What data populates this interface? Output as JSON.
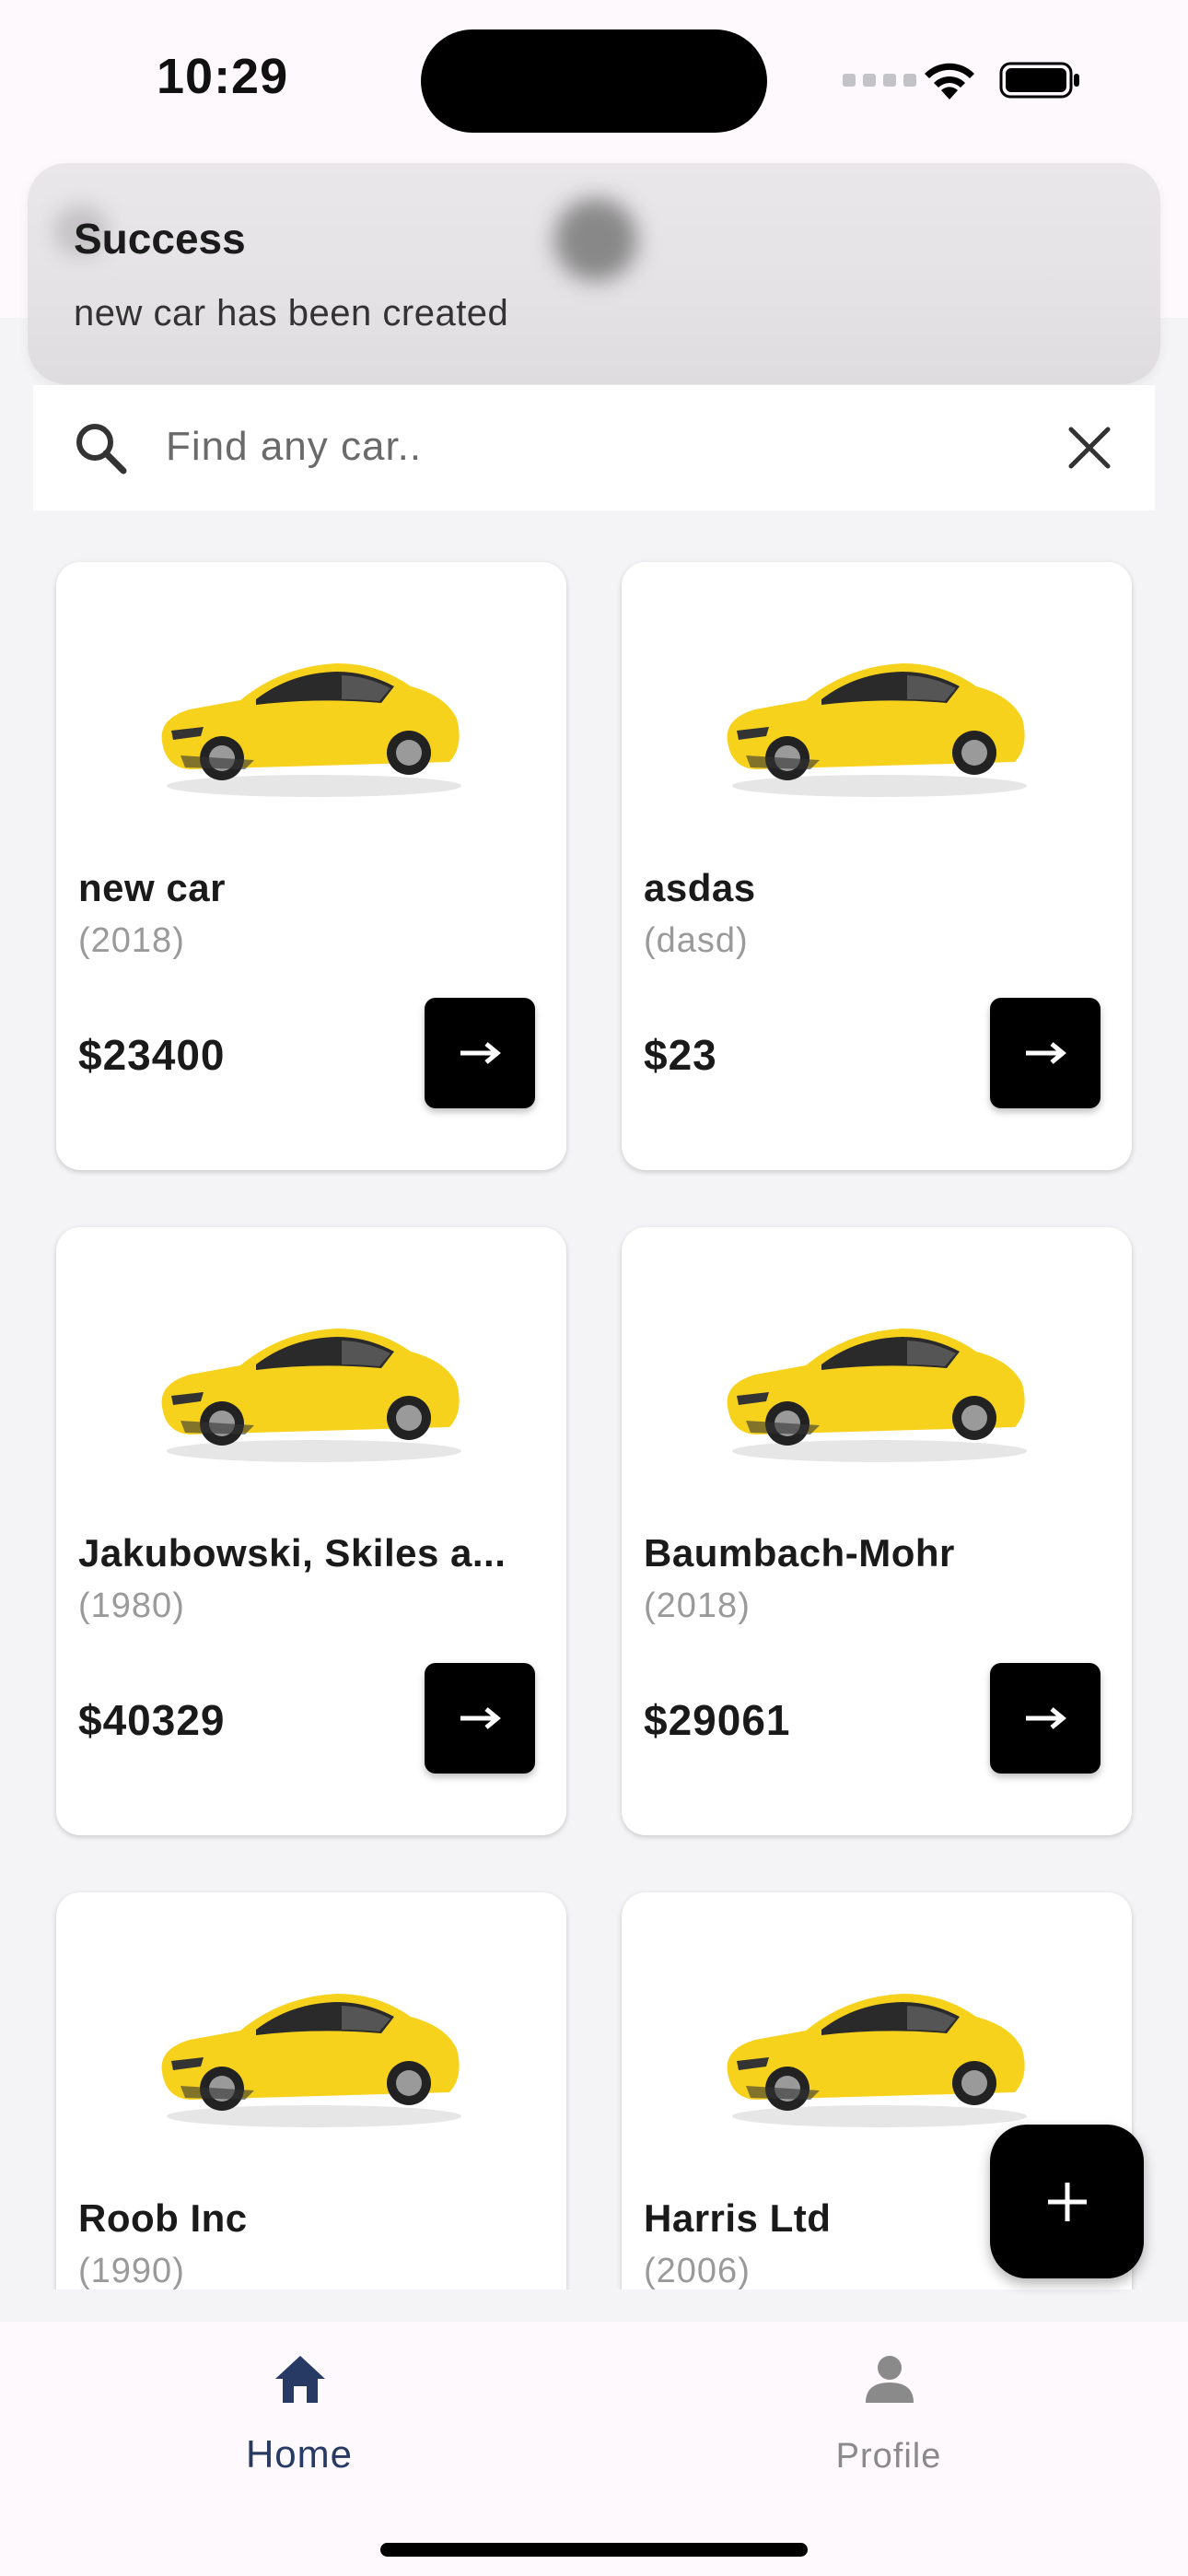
{
  "status_bar": {
    "time": "10:29"
  },
  "toast": {
    "title": "Success",
    "message": "new car has been created"
  },
  "search": {
    "placeholder": "Find any car..",
    "value": ""
  },
  "cars": [
    {
      "name": "new car",
      "year": "(2018)",
      "price": "$23400",
      "button_symbol": "→"
    },
    {
      "name": "asdas",
      "year": "(dasd)",
      "price": "$23",
      "button_symbol": "→"
    },
    {
      "name": "Jakubowski, Skiles a...",
      "year": "(1980)",
      "price": "$40329",
      "button_symbol": "→"
    },
    {
      "name": "Baumbach-Mohr",
      "year": "(2018)",
      "price": "$29061",
      "button_symbol": "→"
    },
    {
      "name": "Roob Inc",
      "year": "(1990)"
    },
    {
      "name": "Harris Ltd",
      "year": "(2006)"
    }
  ],
  "fab": {
    "symbol": "+"
  },
  "bottom_nav": {
    "items": [
      {
        "label": "Home",
        "icon": "home-icon",
        "active": true
      },
      {
        "label": "Profile",
        "icon": "person-icon",
        "active": false
      }
    ]
  },
  "colors": {
    "accent": "#273a63",
    "car_body": "#f7d21c",
    "button_bg": "#000000",
    "inactive": "#8a8a8a"
  }
}
